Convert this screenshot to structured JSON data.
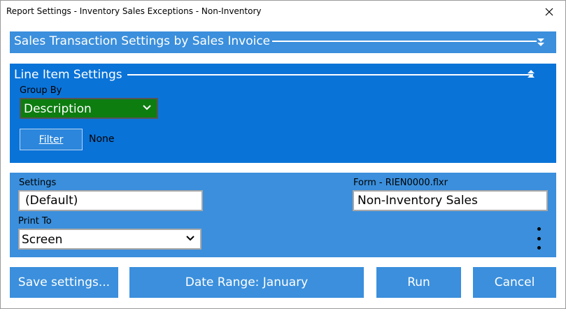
{
  "window": {
    "title": "Report Settings - Inventory Sales Exceptions - Non-Inventory"
  },
  "sales_section": {
    "title": "Sales Transaction Settings by Sales Invoice"
  },
  "line_item_section": {
    "title": "Line Item Settings",
    "group_by_label": "Group By",
    "group_by_value": "Description",
    "filter_label": "Filter",
    "filter_value": "None"
  },
  "output_section": {
    "settings_label": "Settings",
    "settings_value": "(Default)",
    "print_to_label": "Print To",
    "print_to_value": "Screen",
    "form_label": "Form - RIEN0000.flxr",
    "form_value": "Non-Inventory Sales"
  },
  "buttons": {
    "save_settings": "Save settings...",
    "date_range": "Date Range: January",
    "run": "Run",
    "cancel": "Cancel"
  },
  "colors": {
    "section_blue": "#3b8fdc",
    "active_section_blue": "#0a73d8",
    "group_by_green": "#0d7d10"
  }
}
